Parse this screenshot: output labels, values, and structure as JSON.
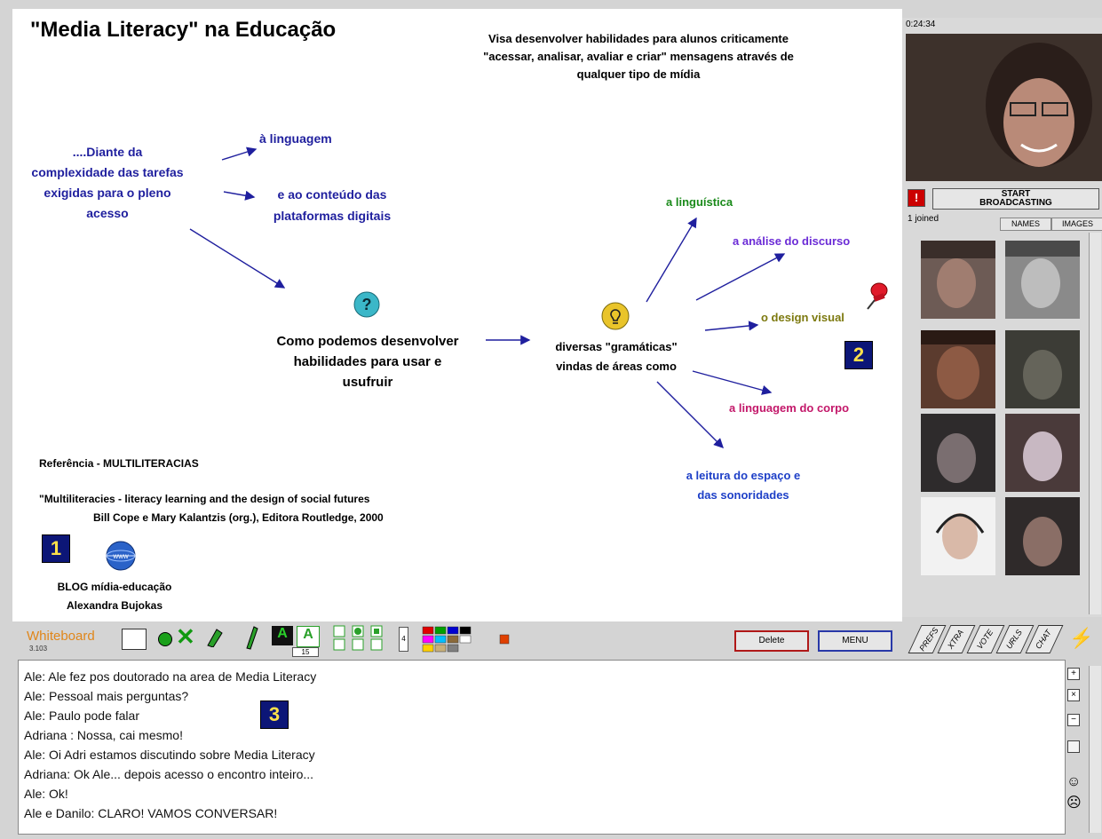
{
  "board": {
    "title": "\"Media Literacy\" na Educação",
    "intro": [
      "Visa desenvolver habilidades para alunos  criticamente",
      "\"acessar, analisar, avaliar e criar\" mensagens através de",
      "qualquer tipo de mídia"
    ],
    "diante": [
      "....Diante da",
      "complexidade das tarefas",
      "exigidas para  o pleno",
      "acesso"
    ],
    "linguagem": "à linguagem",
    "conteudo": [
      "e ao conteúdo das",
      "plataformas digitais"
    ],
    "question": [
      "Como podemos desenvolver",
      "habilidades para usar e",
      "usufruir"
    ],
    "gramaticas": [
      "diversas \"gramáticas\"",
      "vindas de  áreas como"
    ],
    "linguistica": "a linguística",
    "discurso": "a análise do discurso",
    "design": "o design visual",
    "corpo": "a linguagem do corpo",
    "espaco": [
      "a leitura do espaço e",
      "das sonoridades"
    ],
    "ref_title": "Referência - MULTILITERACIAS",
    "ref_line1": "\"Multiliteracies - literacy learning and the design of social futures",
    "ref_line2": "Bill Cope e Mary Kalantzis (org.), Editora Routledge, 2000",
    "blog": [
      "BLOG mídia-educação",
      "Alexandra Bujokas"
    ],
    "badge1": "1",
    "badge2": "2",
    "badge3": "3",
    "question_icon": "question-icon",
    "idea_icon": "lightbulb-icon",
    "globe_icon": "globe-icon",
    "pin_icon": "pushpin-icon"
  },
  "right": {
    "timer": "0:24:34",
    "broadcast": [
      "START",
      "BROADCASTING"
    ],
    "joined": "1 joined",
    "tab_names": "NAMES",
    "tab_images": "IMAGES"
  },
  "toolbar": {
    "whiteboard": "Whiteboard",
    "version": "3.103",
    "size_value": "15",
    "page_num": "4",
    "delete": "Delete",
    "menu": "MENU",
    "tabs": [
      "PREFS",
      "XTRA",
      "VOTE",
      "URLS",
      "CHAT"
    ],
    "colors": [
      "#e00000",
      "#00a000",
      "#0000d0",
      "#000000",
      "#ff00ff",
      "#00c0ff",
      "#8b6a3a",
      "#ffffff",
      "#ffd000",
      "#c8b07a",
      "#808080",
      "#e04000"
    ]
  },
  "chat": {
    "lines": [
      "Ale: Ale fez pos doutorado na area de Media Literacy",
      "Ale: Pessoal mais perguntas?",
      "Ale: Paulo pode falar",
      "Adriana : Nossa, cai mesmo!",
      "Ale: Oi Adri estamos discutindo sobre Media Literacy",
      "Adriana: Ok Ale... depois acesso o encontro inteiro...",
      "Ale: Ok!",
      "Ale e Danilo: CLARO! VAMOS CONVERSAR!"
    ]
  }
}
